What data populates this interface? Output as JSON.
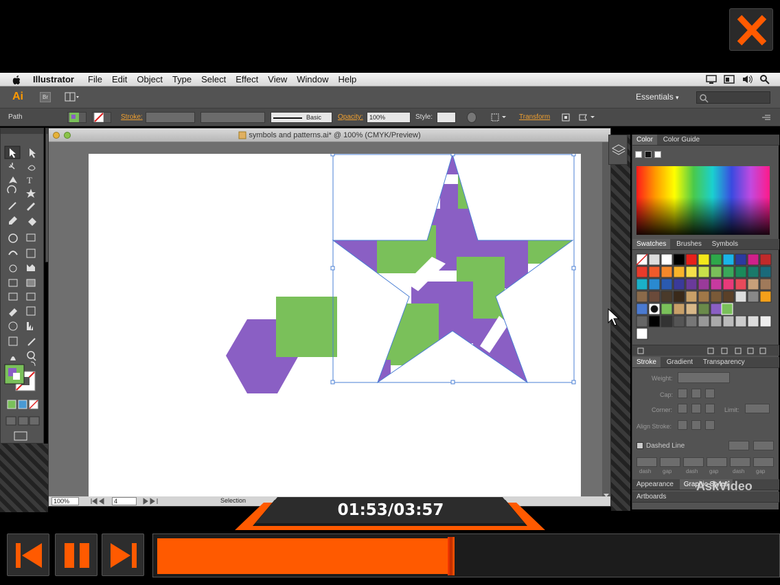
{
  "player": {
    "elapsed": "01:53",
    "total": "03:57",
    "timecode": "01:53/03:57",
    "progress_fraction": 0.477,
    "accent_color": "#ff5a00"
  },
  "menubar": {
    "app_name": "Illustrator",
    "menus": [
      "File",
      "Edit",
      "Object",
      "Type",
      "Select",
      "Effect",
      "View",
      "Window",
      "Help"
    ]
  },
  "appbar": {
    "logo": "Ai",
    "bridge_label": "Br",
    "workspace": "Essentials"
  },
  "controlbar": {
    "selection_label": "Path",
    "stroke_label": "Stroke:",
    "brush_label": "Basic",
    "opacity_label": "Opacity:",
    "opacity_value": "100%",
    "style_label": "Style:",
    "transform_label": "Transform"
  },
  "document": {
    "title": "symbols and patterns.ai* @ 100% (CMYK/Preview)",
    "zoom": "100%",
    "page": "4",
    "status": "Selection"
  },
  "colors": {
    "purple": "#8a5fc4",
    "green": "#7ac05a",
    "selection": "#4a7fd4"
  },
  "panels": {
    "color_tabs": [
      "Color",
      "Color Guide"
    ],
    "swatch_tabs": [
      "Swatches",
      "Brushes",
      "Symbols"
    ],
    "stroke_tabs": [
      "Stroke",
      "Gradient",
      "Transparency"
    ],
    "stroke_fields": {
      "weight": "Weight:",
      "cap": "Cap:",
      "corner": "Corner:",
      "limit": "Limit:",
      "align": "Align Stroke:",
      "dashed": "Dashed Line",
      "dash_labels": [
        "dash",
        "gap",
        "dash",
        "gap",
        "dash",
        "gap"
      ]
    },
    "bottom_tabs": [
      "Appearance",
      "Graphic Styles"
    ],
    "artboards_label": "Artboards"
  },
  "watermark": "AskVideo"
}
